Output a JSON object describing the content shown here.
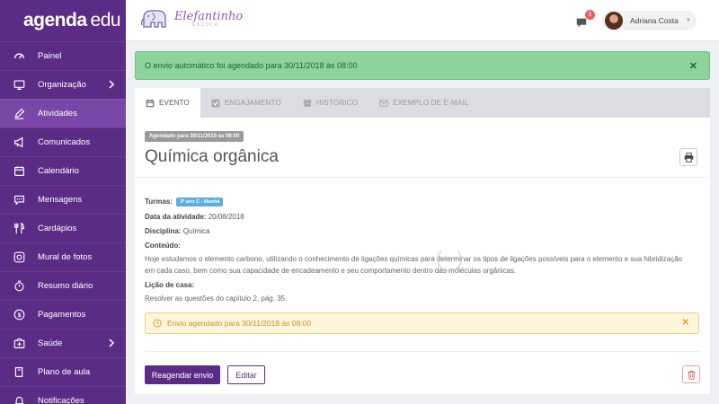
{
  "sidebar": {
    "logo_bold": "agenda",
    "logo_light": "edu",
    "items": [
      {
        "label": "Painel",
        "icon": "dashboard-icon"
      },
      {
        "label": "Organização",
        "icon": "monitor-icon"
      },
      {
        "label": "Atividades",
        "icon": "pencil-icon"
      },
      {
        "label": "Comunicados",
        "icon": "megaphone-icon"
      },
      {
        "label": "Calendário",
        "icon": "calendar-icon"
      },
      {
        "label": "Mensagens",
        "icon": "chat-icon"
      },
      {
        "label": "Cardápios",
        "icon": "utensils-icon"
      },
      {
        "label": "Mural de fotos",
        "icon": "camera-icon"
      },
      {
        "label": "Resumo diário",
        "icon": "timer-icon"
      },
      {
        "label": "Pagamentos",
        "icon": "dollar-icon"
      },
      {
        "label": "Saúde",
        "icon": "medkit-icon"
      },
      {
        "label": "Plano de aula",
        "icon": "book-icon"
      },
      {
        "label": "Notificações",
        "icon": "bell-icon"
      }
    ],
    "active_index": 2
  },
  "header": {
    "school_name": "Elefantinho",
    "school_sub": "ESCOLA",
    "notification_count": "5",
    "user_name": "Adriana Costa"
  },
  "alert_success": {
    "text": "O envio automático foi agendado para 30/11/2018 às 08:00",
    "close": "✕"
  },
  "tabs": [
    {
      "label": "EVENTO",
      "icon": "calendar-icon"
    },
    {
      "label": "ENGAJAMENTO",
      "icon": "check-square-icon"
    },
    {
      "label": "HISTÓRICO",
      "icon": "archive-icon"
    },
    {
      "label": "EXEMPLO DE E-MAIL",
      "icon": "envelope-icon"
    }
  ],
  "card": {
    "schedule_badge": "Agendado para 30/11/2018 às 08:00",
    "title": "Química orgânica",
    "turmas_label": "Turmas:",
    "turma_tag": "3º ano C - Manhã",
    "date_label": "Data da atividade:",
    "date_value": "20/08/2018",
    "discipline_label": "Disciplina:",
    "discipline_value": "Química",
    "content_label": "Conteúdo:",
    "content_text": "Hoje estudamos o elemento carbono, utilizando o conhecimento de ligações químicas para determinar os tipos de ligações possíveis para o elemento e sua hibridização em cada caso, bem como sua capacidade de encadeamento e seu comportamento dentro das moléculas orgânicas.",
    "homework_label": "Lição de casa:",
    "homework_text": "Resolver as questões do capítulo 2, pág. 35.",
    "warning_text": "Envio agendado para 30/11/2018 às 08:00",
    "warning_close": "✕",
    "reschedule_label": "Reagendar envio",
    "edit_label": "Editar"
  },
  "colors": {
    "brand": "#5b2c86",
    "success_bg": "#8ed39b",
    "warning_bg": "#fdf6dc",
    "turma_tag": "#5dade2"
  }
}
